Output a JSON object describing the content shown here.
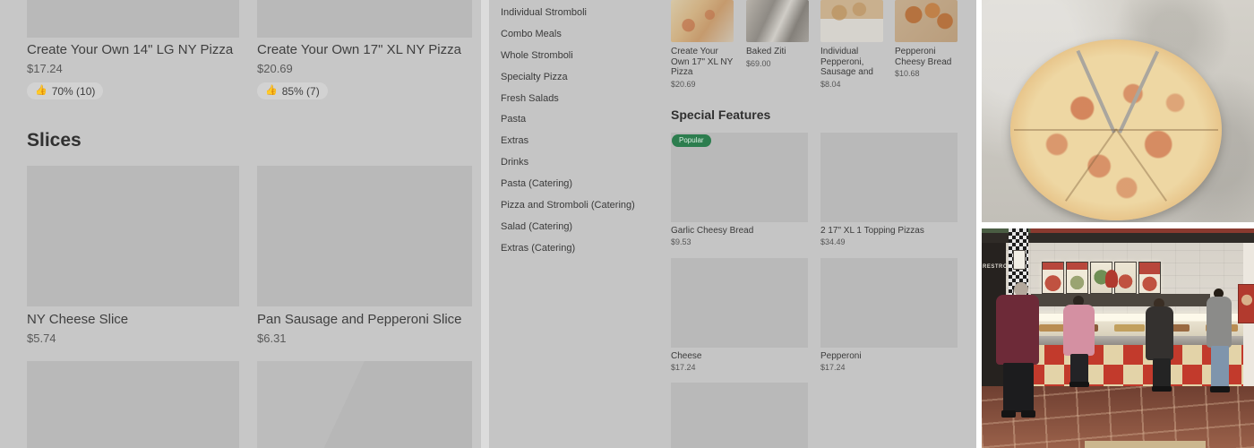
{
  "theme": {
    "page_bg": "#c7c7c7",
    "panel_bg": "#c5c5c5",
    "placeholder": "#b9b9b9",
    "pill_bg": "#d2d2d2",
    "text_primary": "#3f3f3f",
    "text_secondary": "#5a5a5a",
    "badge_green": "#2c7d4e",
    "counter_red": "#c23a2c",
    "counter_cream": "#e3d3a8"
  },
  "left_menu": {
    "items_top": [
      {
        "name": "Create Your Own 14\" LG NY Pizza",
        "price": "$17.24",
        "rating": "70% (10)"
      },
      {
        "name": "Create Your Own 17\" XL NY Pizza",
        "price": "$20.69",
        "rating": "85% (7)"
      }
    ],
    "section_title": "Slices",
    "items_slices": [
      {
        "name": "NY Cheese Slice",
        "price": "$5.74"
      },
      {
        "name": "Pan Sausage and Pepperoni Slice",
        "price": "$6.31"
      }
    ]
  },
  "category_nav": {
    "items": [
      "Individual Stromboli",
      "Combo Meals",
      "Whole Stromboli",
      "Specialty Pizza",
      "Fresh Salads",
      "Pasta",
      "Extras",
      "Drinks",
      "Pasta (Catering)",
      "Pizza and Stromboli (Catering)",
      "Salad (Catering)",
      "Extras (Catering)"
    ]
  },
  "featured_row": {
    "items": [
      {
        "name": "Create Your Own 17\" XL NY Pizza",
        "price": "$20.69"
      },
      {
        "name": "Baked Ziti",
        "price": "$69.00"
      },
      {
        "name": "Individual Pepperoni, Sausage and …",
        "price": "$8.04"
      },
      {
        "name": "Pepperoni Cheesy Bread",
        "price": "$10.68"
      }
    ]
  },
  "special_features": {
    "title": "Special Features",
    "items": [
      {
        "name": "Garlic Cheesy Bread",
        "price": "$9.53",
        "badge": "Popular"
      },
      {
        "name": "2 17\" XL 1 Topping Pizzas",
        "price": "$34.49"
      },
      {
        "name": "Cheese",
        "price": "$17.24"
      },
      {
        "name": "Pepperoni",
        "price": "$17.24"
      }
    ]
  },
  "photos": {
    "restroom_sign": "RESTRO"
  },
  "icons": {
    "thumbs_up": "👍"
  }
}
